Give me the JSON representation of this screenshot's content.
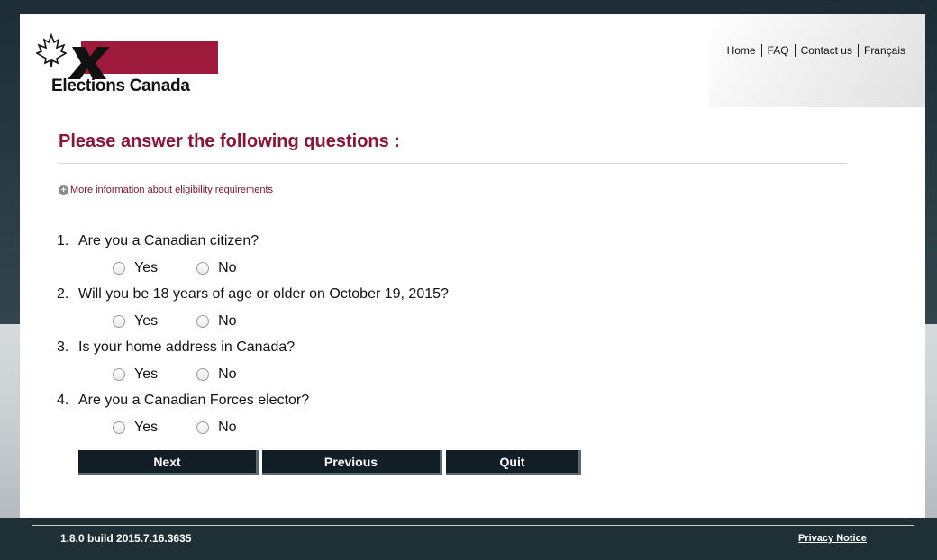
{
  "header": {
    "logo_text": "Elections Canada",
    "nav": [
      "Home",
      "FAQ",
      "Contact us",
      "Français"
    ]
  },
  "main": {
    "title": "Please answer the following questions :",
    "more_info": "More information about eligibility requirements",
    "questions": [
      {
        "num": "1.",
        "text": "Are you a Canadian citizen?",
        "yes": "Yes",
        "no": "No"
      },
      {
        "num": "2.",
        "text": "Will you be 18 years of age or older on October 19, 2015?",
        "yes": "Yes",
        "no": "No"
      },
      {
        "num": "3.",
        "text": "Is your home address in Canada?",
        "yes": "Yes",
        "no": "No"
      },
      {
        "num": "4.",
        "text": "Are you a Canadian Forces elector?",
        "yes": "Yes",
        "no": "No"
      }
    ],
    "buttons": {
      "next": "Next",
      "previous": "Previous",
      "quit": "Quit"
    }
  },
  "footer": {
    "version": "1.8.0 build 2015.7.16.3635",
    "privacy": "Privacy Notice"
  },
  "colors": {
    "brand": "#9e1b3e",
    "title": "#8a1538",
    "button": "#121e26"
  },
  "icons": [
    "maple-leaf-icon",
    "x-mark-icon",
    "plus-circle-icon"
  ]
}
